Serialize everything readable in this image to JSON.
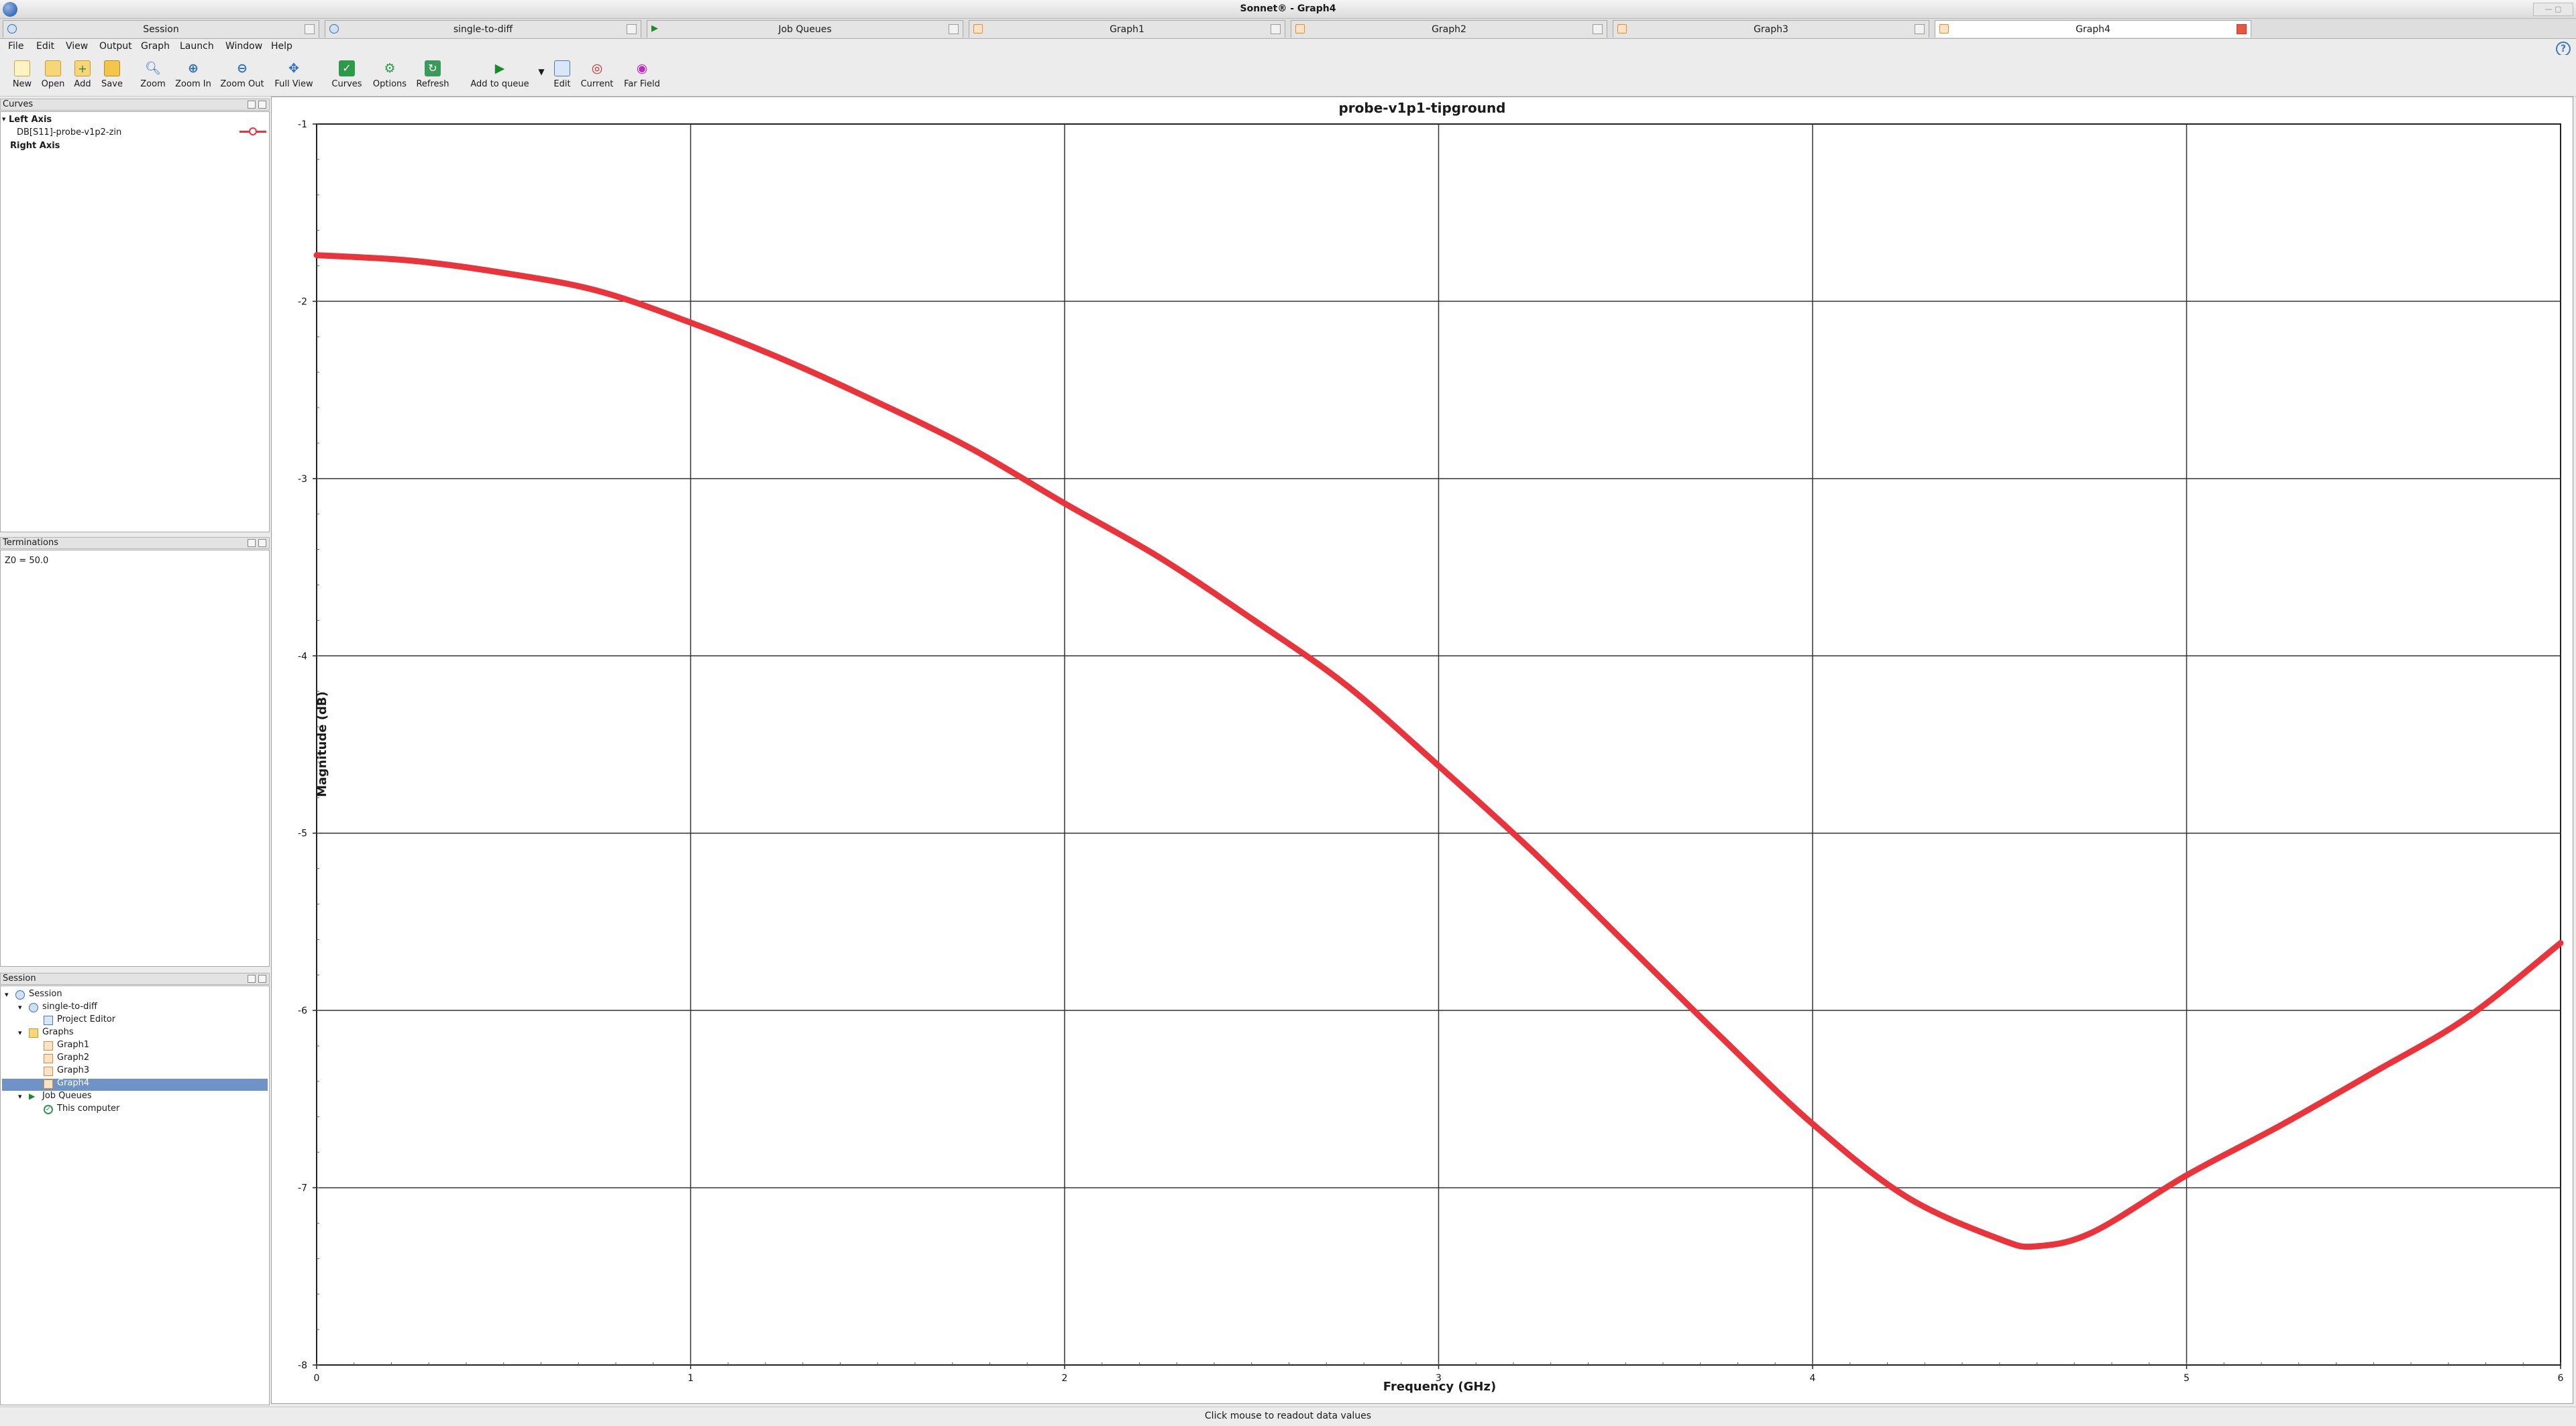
{
  "window": {
    "title": "Sonnet® - Graph4"
  },
  "tabs": [
    {
      "label": "Session",
      "icon": "session-icon"
    },
    {
      "label": "single-to-diff",
      "icon": "project-icon"
    },
    {
      "label": "Job Queues",
      "icon": "queue-icon"
    },
    {
      "label": "Graph1",
      "icon": "graph-icon"
    },
    {
      "label": "Graph2",
      "icon": "graph-icon"
    },
    {
      "label": "Graph3",
      "icon": "graph-icon"
    },
    {
      "label": "Graph4",
      "icon": "graph-icon",
      "active": true
    }
  ],
  "menu": [
    "File",
    "Edit",
    "View",
    "Output",
    "Graph",
    "Launch",
    "Window",
    "Help"
  ],
  "toolbar": {
    "new": "New",
    "open": "Open",
    "add": "Add",
    "save": "Save",
    "zoom": "Zoom",
    "zoom_in": "Zoom In",
    "zoom_out": "Zoom Out",
    "full_view": "Full View",
    "curves": "Curves",
    "options": "Options",
    "refresh": "Refresh",
    "add_to_queue": "Add to queue",
    "edit": "Edit",
    "current": "Current",
    "far_field": "Far Field"
  },
  "curves_panel": {
    "title": "Curves",
    "left_axis": "Left Axis",
    "curve_name": "DB[S11]-probe-v1p2-zin",
    "right_axis": "Right Axis",
    "curve_color": "#e8343a"
  },
  "terminations_panel": {
    "title": "Terminations",
    "z0": "Z0 = 50.0"
  },
  "session_panel": {
    "title": "Session",
    "session": "Session",
    "project": "single-to-diff",
    "project_editor": "Project Editor",
    "graphs": "Graphs",
    "graph1": "Graph1",
    "graph2": "Graph2",
    "graph3": "Graph3",
    "graph4": "Graph4",
    "job_queues": "Job Queues",
    "this_computer": "This computer"
  },
  "status": "Click mouse to readout data values",
  "chart_data": {
    "type": "line",
    "title": "probe-v1p1-tipground",
    "xlabel": "Frequency (GHz)",
    "ylabel": "Magnitude (dB)",
    "xlim": [
      0,
      6
    ],
    "ylim": [
      -8,
      -1
    ],
    "x_ticks": [
      "0",
      "1",
      "2",
      "3",
      "4",
      "5",
      "6"
    ],
    "y_ticks": [
      "-1",
      "-2",
      "-3",
      "-4",
      "-5",
      "-6",
      "-7",
      "-8"
    ],
    "grid": true,
    "series": [
      {
        "name": "DB[S11]-probe-v1p2-zin",
        "color": "#e8343a",
        "x": [
          0,
          0.25,
          0.5,
          0.75,
          1.0,
          1.25,
          1.5,
          1.75,
          2.0,
          2.25,
          2.5,
          2.75,
          3.0,
          3.25,
          3.5,
          3.75,
          4.0,
          4.25,
          4.5,
          4.6,
          4.75,
          5.0,
          5.25,
          5.5,
          5.75,
          6.0
        ],
        "y": [
          -1.74,
          -1.77,
          -1.84,
          -1.94,
          -2.12,
          -2.33,
          -2.57,
          -2.83,
          -3.14,
          -3.44,
          -3.79,
          -4.16,
          -4.62,
          -5.1,
          -5.62,
          -6.14,
          -6.64,
          -7.05,
          -7.29,
          -7.33,
          -7.25,
          -6.93,
          -6.65,
          -6.35,
          -6.04,
          -5.62
        ]
      }
    ]
  }
}
